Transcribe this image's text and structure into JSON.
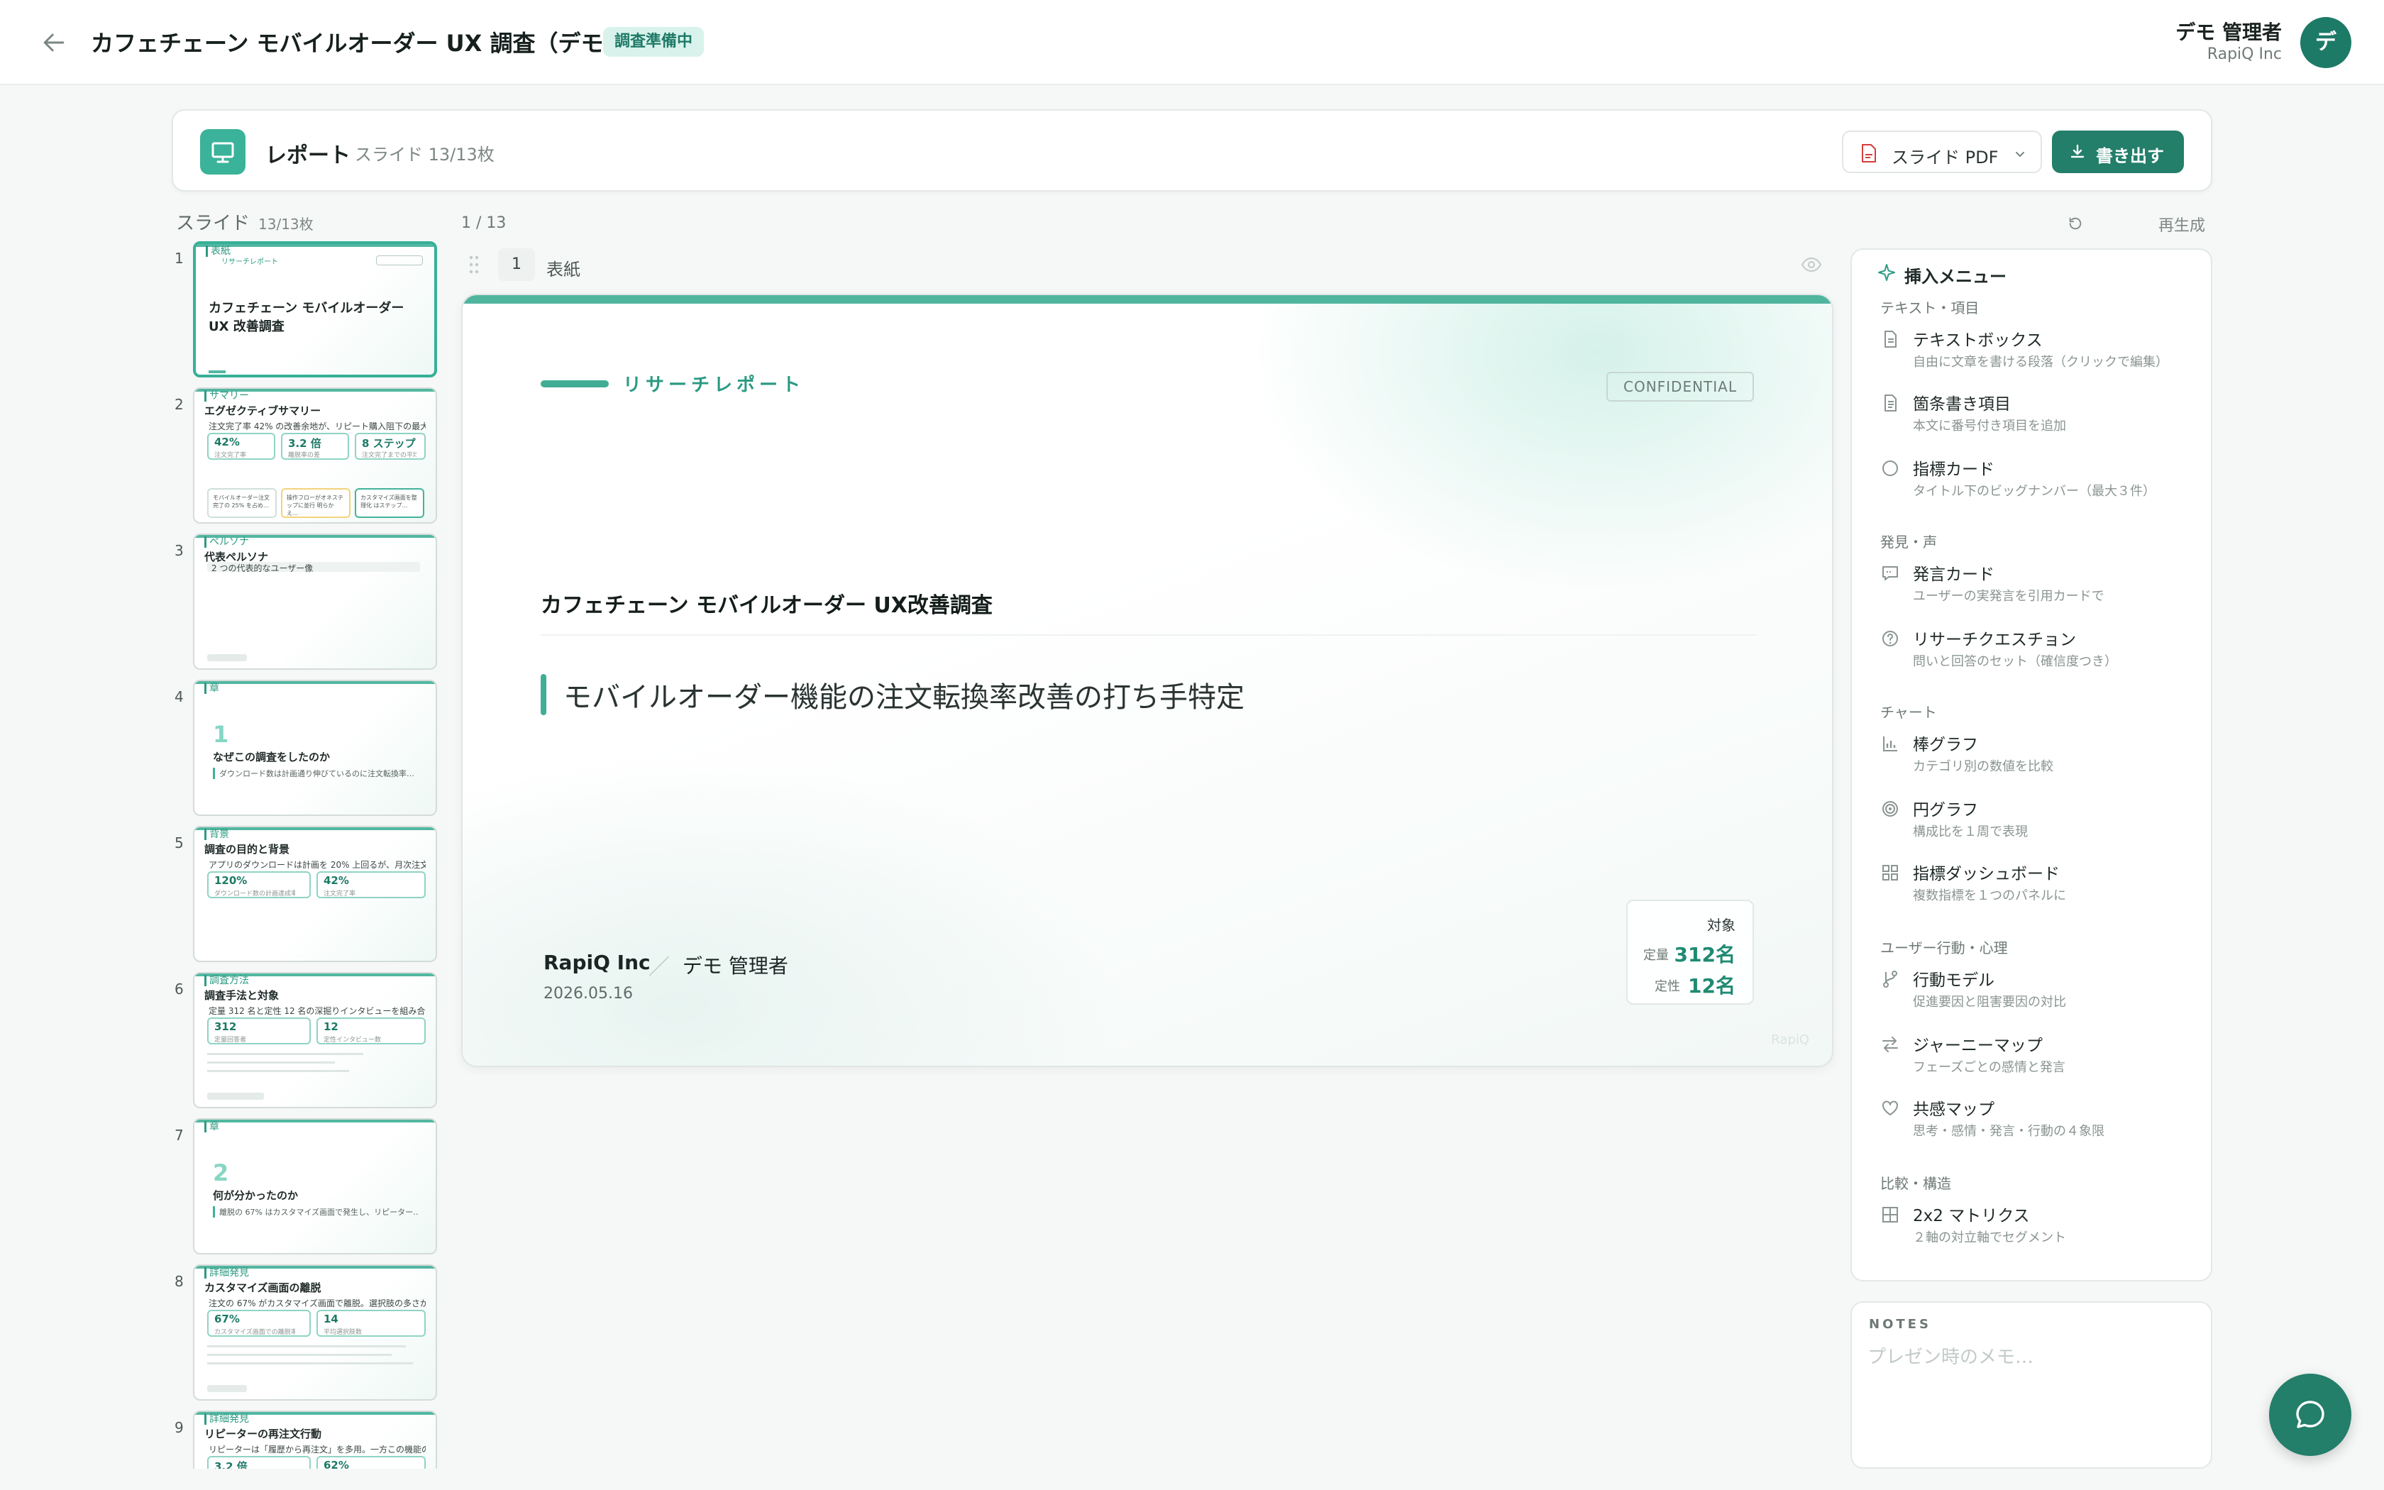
{
  "header": {
    "title": "カフェチェーン モバイルオーダー UX 調査（デモ）",
    "status": "調査準備中",
    "user_name": "デモ 管理者",
    "user_org": "RapiQ Inc",
    "avatar_initial": "デ"
  },
  "report": {
    "title": "レポート",
    "count": "スライド 13/13枚",
    "pdf_label": "スライド PDF",
    "export_label": "書き出す"
  },
  "slides": {
    "heading": "スライド",
    "count": "13/13枚",
    "items": [
      {
        "num": "1",
        "section": "表紙",
        "label": "リサーチレポート",
        "title": "カフェチェーン モバイルオーダー UX 改善調査"
      },
      {
        "num": "2",
        "section": "サマリー",
        "title": "エグゼクティブサマリー",
        "sub": "注文完了率 42% の改善余地が、リピート購入阻下の最大要因と判…",
        "m1": "42%",
        "m1l": "注文完了率",
        "m2": "3.2 倍",
        "m2l": "離脱率の差",
        "m3": "8 ステップ",
        "m3l": "注文完了までの平均タ…",
        "c1": "モバイルオーダー注文完了の 25% を占め…",
        "c2": "操作フローがオネステップに並行 明らかえ…",
        "c3": "カスタマイズ画面を整理化 はステップ…"
      },
      {
        "num": "3",
        "section": "ペルソナ",
        "title": "代表ペルソナ",
        "sub": "2 つの代表的なユーザー像"
      },
      {
        "num": "4",
        "section": "章",
        "chapter": "1",
        "title": "なぜこの調査をしたのか",
        "sub": "ダウンロード数は計画通り伸びているのに注文転換率…"
      },
      {
        "num": "5",
        "section": "背景",
        "title": "調査の目的と背景",
        "sub": "アプリのダウンロードは計画を 20% 上回るが、月次注文転換率…",
        "m1": "120%",
        "m1l": "ダウンロード数の計画達成率",
        "m2": "42%",
        "m2l": "注文完了率"
      },
      {
        "num": "6",
        "section": "調査方法",
        "title": "調査手法と対象",
        "sub": "定量 312 名と定性 12 名の深掘りインタビューを組み合わせた複合…",
        "m1": "312",
        "m1l": "定量回答者",
        "m2": "12",
        "m2l": "定性インタビュー数"
      },
      {
        "num": "7",
        "section": "章",
        "chapter": "2",
        "title": "何が分かったのか",
        "sub": "離脱の 67% はカスタマイズ画面で発生し、リピーター…"
      },
      {
        "num": "8",
        "section": "詳細発見",
        "title": "カスタマイズ画面の離脱",
        "sub": "注文の 67% がカスタマイズ画面で離脱。選択肢の多さが心理的…",
        "m1": "67%",
        "m1l": "カスタマイズ画面での離脱率",
        "m2": "14",
        "m2l": "平均選択肢数"
      },
      {
        "num": "9",
        "section": "詳細発見",
        "title": "リピーターの再注文行動",
        "sub": "リピーターは「履歴から再注文」を多用。一方この機能の存在を…",
        "m1": "3.2 倍",
        "m1l": "",
        "m2": "62%",
        "m2l": ""
      }
    ]
  },
  "editor": {
    "page_indicator": "1 / 13",
    "regenerate": "再生成",
    "slide_index": "1",
    "slide_type": "表紙"
  },
  "slide": {
    "eyebrow": "リサーチレポート",
    "confidential": "CONFIDENTIAL",
    "title": "カフェチェーン モバイルオーダー UX改善調査",
    "subtitle": "モバイルオーダー機能の注文転換率改善の打ち手特定",
    "company": "RapiQ Inc",
    "separator": "／",
    "author": "デモ 管理者",
    "date": "2026.05.16",
    "target_heading": "対象",
    "quant_label": "定量",
    "quant_value": "312名",
    "qual_label": "定性",
    "qual_value": "12名",
    "watermark": "RapiQ"
  },
  "insert_menu": {
    "heading": "挿入メニュー",
    "groups": [
      {
        "label": "テキスト・項目",
        "items": [
          {
            "icon": "document-icon",
            "label": "テキストボックス",
            "desc": "自由に文章を書ける段落（クリックで編集）"
          },
          {
            "icon": "list-document-icon",
            "label": "箇条書き項目",
            "desc": "本文に番号付き項目を追加"
          },
          {
            "icon": "circle-icon",
            "label": "指標カード",
            "desc": "タイトル下のビッグナンバー（最大３件）"
          }
        ]
      },
      {
        "label": "発見・声",
        "items": [
          {
            "icon": "speech-bubble-icon",
            "label": "発言カード",
            "desc": "ユーザーの実発言を引用カードで"
          },
          {
            "icon": "question-icon",
            "label": "リサーチクエスチョン",
            "desc": "問いと回答のセット（確信度つき）"
          }
        ]
      },
      {
        "label": "チャート",
        "items": [
          {
            "icon": "bar-chart-icon",
            "label": "棒グラフ",
            "desc": "カテゴリ別の数値を比較"
          },
          {
            "icon": "target-icon",
            "label": "円グラフ",
            "desc": "構成比を１周で表現"
          },
          {
            "icon": "grid-icon",
            "label": "指標ダッシュボード",
            "desc": "複数指標を１つのパネルに"
          }
        ]
      },
      {
        "label": "ユーザー行動・心理",
        "items": [
          {
            "icon": "branch-icon",
            "label": "行動モデル",
            "desc": "促進要因と阻害要因の対比"
          },
          {
            "icon": "swap-arrows-icon",
            "label": "ジャーニーマップ",
            "desc": "フェーズごとの感情と発言"
          },
          {
            "icon": "heart-icon",
            "label": "共感マップ",
            "desc": "思考・感情・発言・行動の４象限"
          }
        ]
      },
      {
        "label": "比較・構造",
        "items": [
          {
            "icon": "matrix-icon",
            "label": "2x2 マトリクス",
            "desc": "２軸の対立軸でセグメント"
          }
        ]
      }
    ]
  },
  "notes": {
    "label": "NOTES",
    "placeholder": "プレゼン時のメモ…"
  },
  "colors": {
    "accent": "#237e6a",
    "accent_light": "#3fae96",
    "badge_bg": "#d9f2ec"
  }
}
